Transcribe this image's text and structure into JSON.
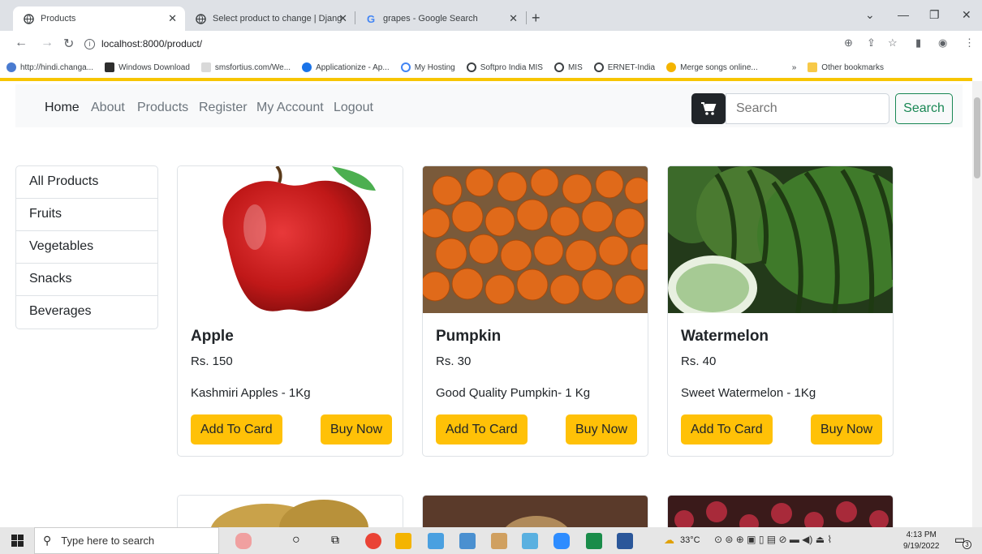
{
  "browser": {
    "tabs": [
      {
        "title": "Products"
      },
      {
        "title": "Select product to change | Djang"
      },
      {
        "title": "grapes - Google Search"
      }
    ],
    "url": "localhost:8000/product/",
    "bookmarks": [
      "http://hindi.changa...",
      "Windows Download",
      "smsfortius.com/We...",
      "Applicationize - Ap...",
      "My Hosting",
      "Softpro India MIS",
      "MIS",
      "ERNET-India",
      "Merge songs online..."
    ],
    "other_bookmarks": "Other bookmarks"
  },
  "navbar": {
    "links": [
      "Home",
      "About",
      "Products",
      "Register",
      "My Account",
      "Logout"
    ],
    "search_placeholder": "Search",
    "search_button": "Search"
  },
  "sidebar": {
    "items": [
      "All Products",
      "Fruits",
      "Vegetables",
      "Snacks",
      "Beverages"
    ]
  },
  "products": [
    {
      "name": "Apple",
      "price": "Rs. 150",
      "description": "Kashmiri Apples - 1Kg",
      "add_label": "Add To Card",
      "buy_label": "Buy Now"
    },
    {
      "name": "Pumpkin",
      "price": "Rs. 30",
      "description": "Good Quality Pumpkin- 1 Kg",
      "add_label": "Add To Card",
      "buy_label": "Buy Now"
    },
    {
      "name": "Watermelon",
      "price": "Rs. 40",
      "description": "Sweet Watermelon - 1Kg",
      "add_label": "Add To Card",
      "buy_label": "Buy Now"
    }
  ],
  "taskbar": {
    "search_placeholder": "Type here to search",
    "temperature": "33°C",
    "time": "4:13 PM",
    "date": "9/19/2022",
    "notifications": "3"
  },
  "colors": {
    "accent": "#ffc107",
    "accent_bar": "#f7c500",
    "search_green": "#198754"
  }
}
